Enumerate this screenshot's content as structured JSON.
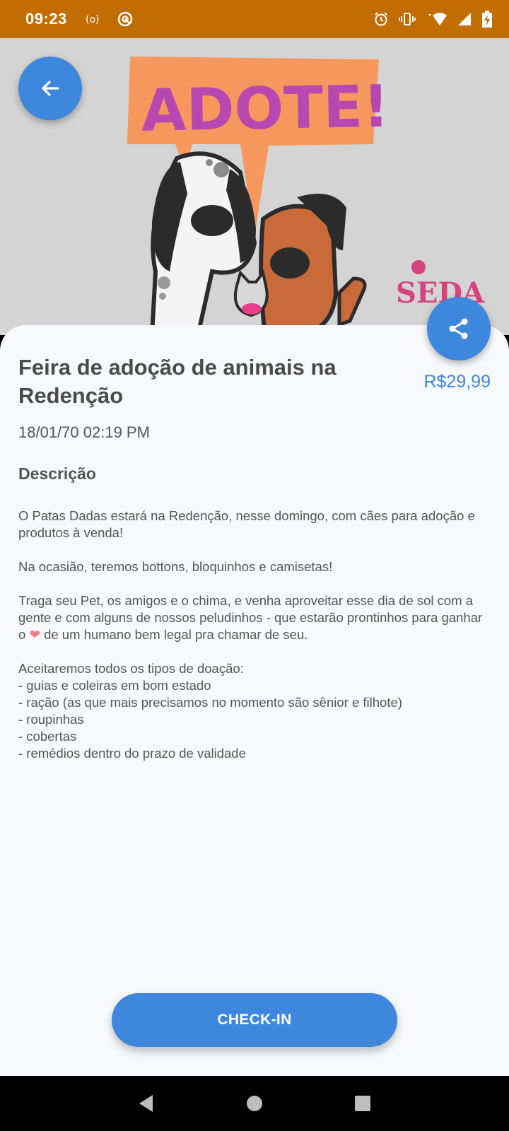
{
  "status_bar": {
    "time": "09:23",
    "left_icons": [
      "broadcast-icon",
      "vpn-icon"
    ],
    "right_icons": [
      "alarm-icon",
      "vibrate-icon",
      "wifi-icon",
      "signal-icon",
      "battery-charging-icon"
    ],
    "background": "#c26d02"
  },
  "hero": {
    "banner_text": "ADOTE!",
    "logo_text": "SEDA"
  },
  "event": {
    "title": "Feira de adoção de animais na Redenção",
    "price": "R$29,99",
    "date": "18/01/70 02:19 PM",
    "description_heading": "Descrição",
    "description": {
      "p1": "O Patas Dadas estará na Redenção, nesse domingo, com cães para adoção e produtos à venda!",
      "p2": "Na ocasião, teremos bottons, bloquinhos e camisetas!",
      "p3_before": "Traga seu Pet, os amigos e o chima, e venha aproveitar esse dia de sol com a gente e com alguns de nossos peludinhos - que estarão prontinhos para ganhar o ",
      "p3_heart": "❤",
      "p3_after": " de um humano bem legal pra chamar de seu.",
      "list_intro": "Aceitaremos todos os tipos de doação:",
      "items": [
        "- guias e coleiras em bom estado",
        "- ração (as que mais precisamos no momento são sênior e filhote)",
        "- roupinhas",
        "- cobertas",
        "- remédios dentro do prazo de validade"
      ]
    }
  },
  "actions": {
    "checkin_label": "CHECK-IN"
  },
  "colors": {
    "accent": "#3d87dc",
    "sheet": "#f8f9fc"
  }
}
